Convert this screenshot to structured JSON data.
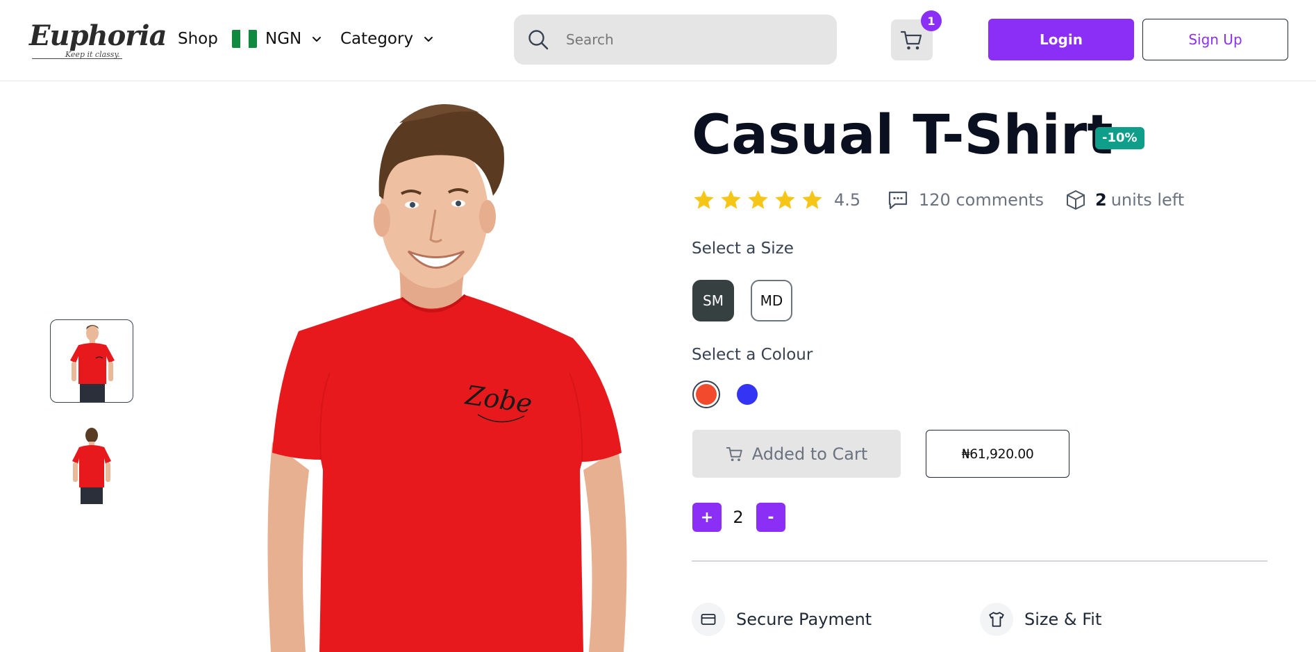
{
  "brand": {
    "name": "Euphoria",
    "tagline": "Keep it classy."
  },
  "nav": {
    "shop": "Shop",
    "currency": "NGN",
    "category": "Category"
  },
  "search": {
    "placeholder": "Search"
  },
  "cart": {
    "count": "1"
  },
  "auth": {
    "login": "Login",
    "signup": "Sign Up"
  },
  "gallery": {
    "thumbnails": [
      "front view",
      "back view"
    ],
    "selected_index": 0
  },
  "product": {
    "title": "Casual T-Shirt",
    "discount": "-10%",
    "rating": "4.5",
    "stars_filled": 5,
    "comments": "120 comments",
    "units_count": "2",
    "units_label": "units left",
    "size_label": "Select a Size",
    "sizes": [
      "SM",
      "MD"
    ],
    "selected_size": "SM",
    "colour_label": "Select a Colour",
    "colours": [
      "#f24a2c",
      "#3434f5"
    ],
    "selected_colour": "#f24a2c",
    "cart_button": "Added to Cart",
    "price": "₦61,920.00",
    "quantity": "2",
    "plus": "+",
    "minus": "-"
  },
  "features": {
    "payment": "Secure Payment",
    "size_fit": "Size & Fit"
  },
  "colors": {
    "accent": "#8b2ff7",
    "discount_badge": "#0f9e8a",
    "star": "#f5c518",
    "tshirt": "#e8191c"
  }
}
